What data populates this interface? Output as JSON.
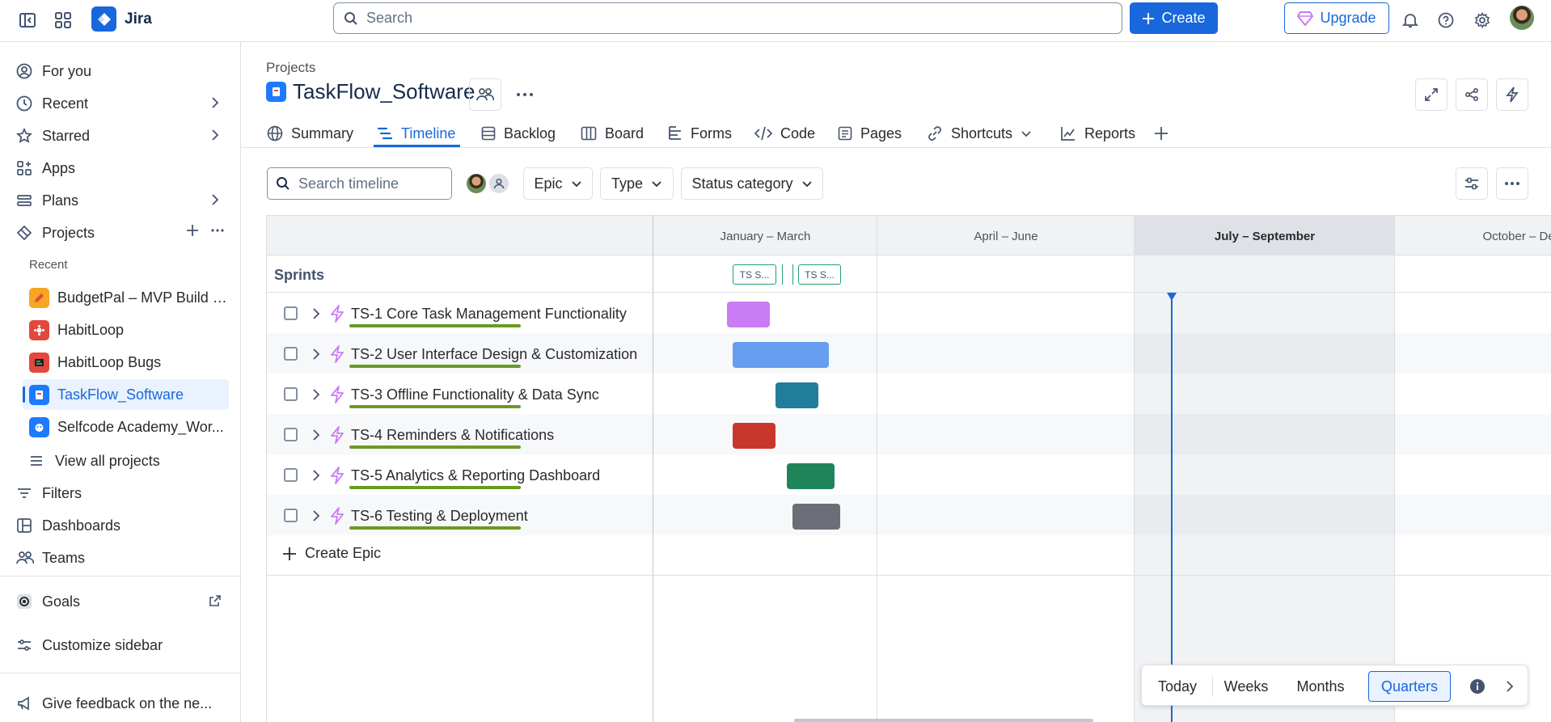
{
  "topbar": {
    "app_name": "Jira",
    "search_placeholder": "Search",
    "create_label": "Create",
    "upgrade_label": "Upgrade"
  },
  "sidebar": {
    "items": [
      {
        "label": "For you",
        "icon": "user-circle-icon"
      },
      {
        "label": "Recent",
        "icon": "clock-icon"
      },
      {
        "label": "Starred",
        "icon": "star-icon"
      },
      {
        "label": "Apps",
        "icon": "apps-icon"
      },
      {
        "label": "Plans",
        "icon": "plans-icon"
      },
      {
        "label": "Projects",
        "icon": "projects-icon"
      }
    ],
    "recent_heading": "Recent",
    "projects": [
      {
        "label": "BudgetPal – MVP Build (...",
        "color": "#f5a623"
      },
      {
        "label": "HabitLoop",
        "color": "#e2483d"
      },
      {
        "label": "HabitLoop Bugs",
        "color": "#e2483d"
      },
      {
        "label": "TaskFlow_Software",
        "color": "#1d7afc"
      },
      {
        "label": "Selfcode Academy_Wor...",
        "color": "#1d7afc"
      }
    ],
    "view_all": "View all projects",
    "bottom_items": [
      {
        "label": "Filters"
      },
      {
        "label": "Dashboards"
      },
      {
        "label": "Teams"
      },
      {
        "label": "Goals"
      },
      {
        "label": "Customize sidebar"
      }
    ],
    "feedback": "Give feedback on the ne..."
  },
  "header": {
    "breadcrumb": "Projects",
    "title": "TaskFlow_Software"
  },
  "tabs": [
    {
      "label": "Summary",
      "icon": "globe-icon"
    },
    {
      "label": "Timeline",
      "icon": "timeline-icon"
    },
    {
      "label": "Backlog",
      "icon": "backlog-icon"
    },
    {
      "label": "Board",
      "icon": "board-icon"
    },
    {
      "label": "Forms",
      "icon": "forms-icon"
    },
    {
      "label": "Code",
      "icon": "code-icon"
    },
    {
      "label": "Pages",
      "icon": "pages-icon"
    },
    {
      "label": "Shortcuts",
      "icon": "link-icon"
    },
    {
      "label": "Reports",
      "icon": "chart-icon"
    }
  ],
  "toolbar": {
    "search_placeholder": "Search timeline",
    "filters": [
      "Epic",
      "Type",
      "Status category"
    ]
  },
  "timeline": {
    "quarters": [
      "January – March",
      "April – June",
      "July – September",
      "October – Dece"
    ],
    "current_quarter": "July – September",
    "sprints_label": "Sprints",
    "sprint_chips": [
      "TS S...",
      "TS S..."
    ],
    "epics": [
      {
        "key": "TS-1",
        "title": "TS-1 Core Task Management Functionality",
        "color": "#c97cf4"
      },
      {
        "key": "TS-2",
        "title": "TS-2 User Interface Design & Customization",
        "color": "#669df1"
      },
      {
        "key": "TS-3",
        "title": "TS-3 Offline Functionality & Data Sync",
        "color": "#227d9b"
      },
      {
        "key": "TS-4",
        "title": "TS-4 Reminders & Notifications",
        "color": "#c9372c"
      },
      {
        "key": "TS-5",
        "title": "TS-5 Analytics & Reporting Dashboard",
        "color": "#1f845a"
      },
      {
        "key": "TS-6",
        "title": "TS-6 Testing & Deployment",
        "color": "#6b6e76"
      }
    ],
    "create_epic": "Create Epic"
  },
  "scale": {
    "options": [
      "Today",
      "Weeks",
      "Months",
      "Quarters"
    ],
    "active": "Quarters"
  },
  "colors": {
    "brand": "#1868db",
    "progress": "#6a9a23"
  }
}
